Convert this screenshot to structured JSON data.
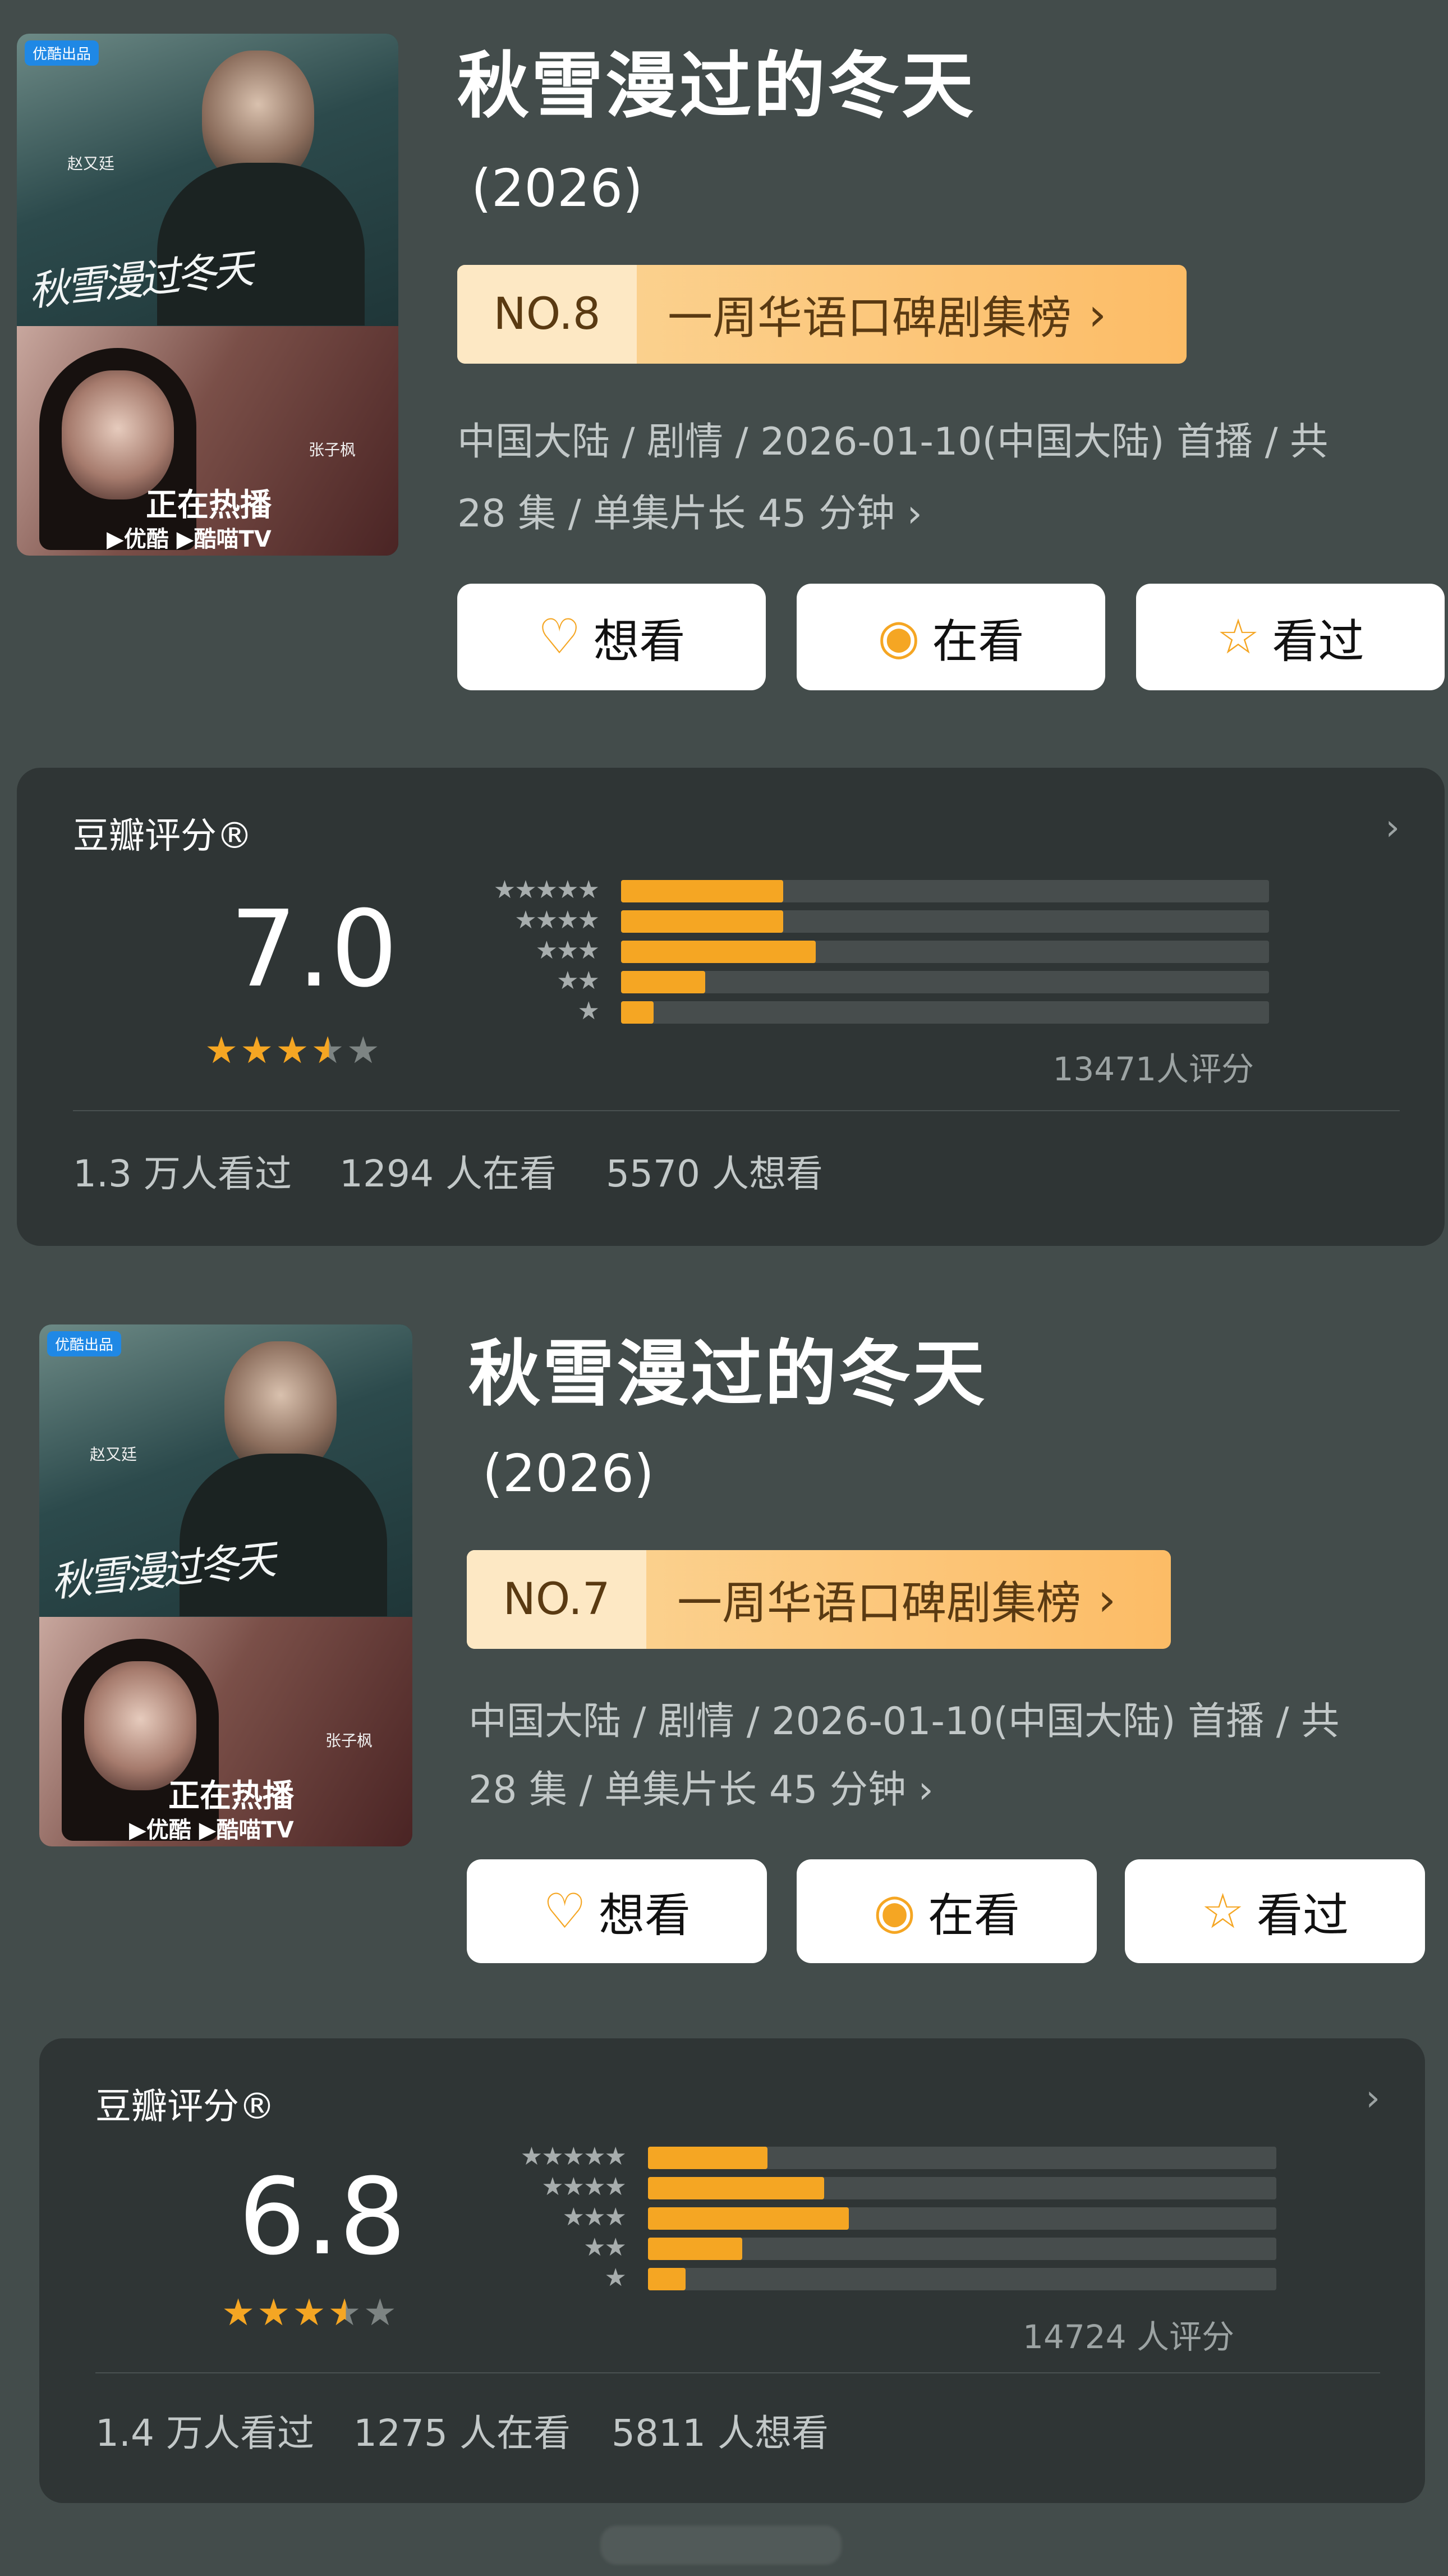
{
  "entries": [
    {
      "poster": {
        "badge": "优酷出品",
        "calligraphy": "秋雪漫过冬天",
        "on_air": "正在热播",
        "platforms": "▶优酷 ▶酷喵TV",
        "actor_left": "赵又廷",
        "actor_right": "张子枫"
      },
      "title": "秋雪漫过的冬天",
      "year": "(2026)",
      "rank": {
        "no": "NO.8",
        "label": "一周华语口碑剧集榜"
      },
      "meta_line1": "中国大陆 / 剧情 / 2026-01-10(中国大陆) 首播 / 共",
      "meta_line2": "28 集 / 单集片长 45 分钟 ›",
      "buttons": [
        {
          "icon": "heart-plus-icon",
          "label": "想看"
        },
        {
          "icon": "target-icon",
          "label": "在看"
        },
        {
          "icon": "star-outline-icon",
          "label": "看过"
        }
      ],
      "rating": {
        "label": "豆瓣评分®",
        "score": "7.0",
        "stars": 3.5,
        "distribution": [
          {
            "stars": "★★★★★",
            "percent": 25
          },
          {
            "stars": "★★★★",
            "percent": 25
          },
          {
            "stars": "★★★",
            "percent": 30
          },
          {
            "stars": "★★",
            "percent": 13
          },
          {
            "stars": "★",
            "percent": 5
          }
        ],
        "count": "13471人评分",
        "stats": [
          "1.3 万人看过",
          "1294 人在看",
          "5570 人想看"
        ]
      }
    },
    {
      "poster": {
        "badge": "优酷出品",
        "calligraphy": "秋雪漫过冬天",
        "on_air": "正在热播",
        "platforms": "▶优酷 ▶酷喵TV",
        "actor_left": "赵又廷",
        "actor_right": "张子枫"
      },
      "title": "秋雪漫过的冬天",
      "year": "(2026)",
      "rank": {
        "no": "NO.7",
        "label": "一周华语口碑剧集榜"
      },
      "meta_line1": "中国大陆 / 剧情 / 2026-01-10(中国大陆) 首播 / 共",
      "meta_line2": "28 集 / 单集片长 45 分钟 ›",
      "buttons": [
        {
          "icon": "heart-plus-icon",
          "label": "想看"
        },
        {
          "icon": "target-icon",
          "label": "在看"
        },
        {
          "icon": "star-outline-icon",
          "label": "看过"
        }
      ],
      "rating": {
        "label": "豆瓣评分®",
        "score": "6.8",
        "stars": 3.5,
        "distribution": [
          {
            "stars": "★★★★★",
            "percent": 19
          },
          {
            "stars": "★★★★",
            "percent": 28
          },
          {
            "stars": "★★★",
            "percent": 32
          },
          {
            "stars": "★★",
            "percent": 15
          },
          {
            "stars": "★",
            "percent": 6
          }
        ],
        "count": "14724 人评分",
        "stats": [
          "1.4 万人看过",
          "1275 人在看",
          "5811 人想看"
        ]
      }
    }
  ],
  "colors": {
    "accent": "#f5a623",
    "background": "#434c4b",
    "card": "#2f3535"
  }
}
